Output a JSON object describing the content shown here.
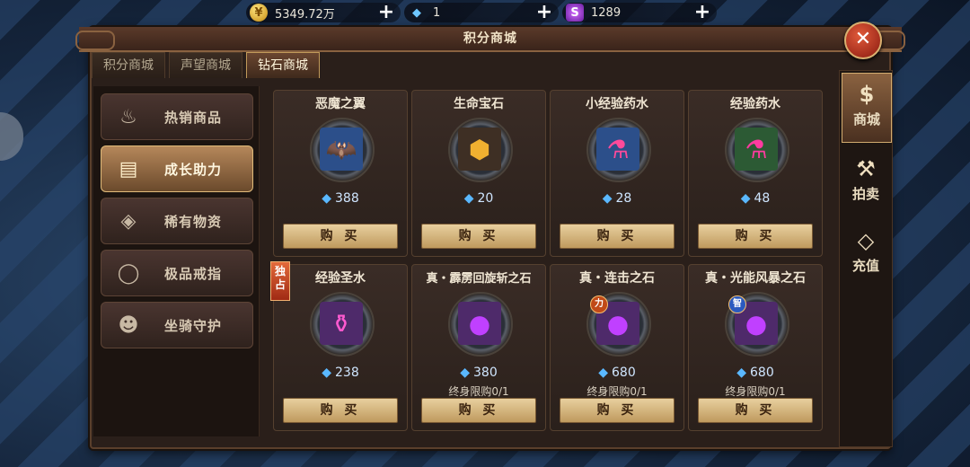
{
  "currencies": [
    {
      "value": "5349.72万",
      "icon": "gold-coin-icon"
    },
    {
      "value": "1",
      "icon": "diamond-icon"
    },
    {
      "value": "1289",
      "icon": "purple-gem-icon"
    }
  ],
  "title": "积分商城",
  "tabs": [
    {
      "label": "积分商城"
    },
    {
      "label": "声望商城"
    },
    {
      "label": "钻石商城"
    }
  ],
  "sidebar": [
    {
      "label": "热销商品",
      "icon": "flame-icon"
    },
    {
      "label": "成长助力",
      "icon": "book-icon"
    },
    {
      "label": "稀有物资",
      "icon": "crystal-icon"
    },
    {
      "label": "极品戒指",
      "icon": "ring-icon"
    },
    {
      "label": "坐骑守护",
      "icon": "panda-icon"
    }
  ],
  "items": [
    {
      "name": "恶魔之翼",
      "price": "388",
      "icon": "demon-wings-icon",
      "buy": "购 买"
    },
    {
      "name": "生命宝石",
      "price": "20",
      "icon": "life-gem-icon",
      "buy": "购 买"
    },
    {
      "name": "小经验药水",
      "price": "28",
      "icon": "small-potion-icon",
      "buy": "购 买"
    },
    {
      "name": "经验药水",
      "price": "48",
      "icon": "potion-icon",
      "buy": "购 买"
    },
    {
      "name": "经验圣水",
      "price": "238",
      "icon": "holy-water-icon",
      "buy": "购 买",
      "badge": "独占"
    },
    {
      "name": "真・霹雳回旋斩之石",
      "price": "380",
      "icon": "purple-orb-icon",
      "buy": "购 买",
      "limit": "终身限购0/1"
    },
    {
      "name": "真・连击之石",
      "price": "680",
      "icon": "purple-orb-icon",
      "buy": "购 买",
      "limit": "终身限购0/1",
      "mini": "力"
    },
    {
      "name": "真・光能风暴之石",
      "price": "680",
      "icon": "purple-orb-icon",
      "buy": "购 买",
      "limit": "终身限购0/1",
      "mini": "智"
    }
  ],
  "rail": [
    {
      "label": "商城",
      "icon": "moneybag-icon"
    },
    {
      "label": "拍卖",
      "icon": "gavel-icon"
    },
    {
      "label": "充值",
      "icon": "diamond-icon"
    }
  ],
  "colors": {
    "accent": "#c19a5a",
    "diamond": "#5ab8ff",
    "buy_button": "#e8cf9e"
  }
}
